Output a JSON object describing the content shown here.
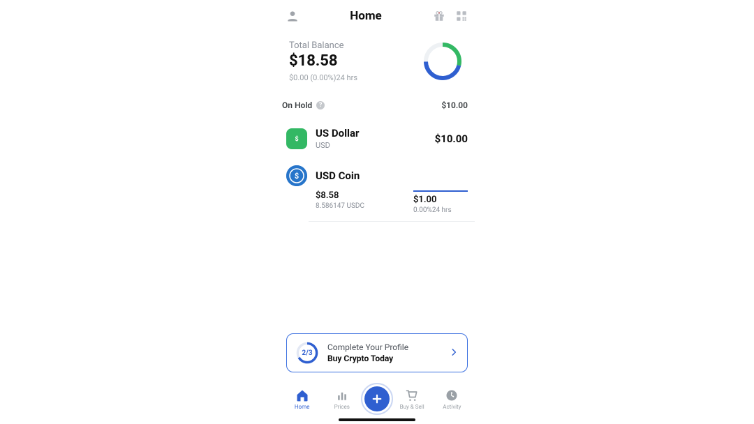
{
  "header": {
    "title": "Home"
  },
  "balance": {
    "label": "Total Balance",
    "amount": "$18.58",
    "change": "$0.00 (0.00%)24 hrs"
  },
  "onhold": {
    "label": "On Hold",
    "amount": "$10.00"
  },
  "assets": {
    "usd": {
      "name": "US Dollar",
      "code": "USD",
      "amount": "$10.00"
    },
    "usdc": {
      "name": "USD Coin",
      "balance": "$8.58",
      "quantity": "8.586147 USDC",
      "price": "$1.00",
      "change": "0.00%24 hrs"
    }
  },
  "profile_card": {
    "progress": "2/3",
    "line1": "Complete Your Profile",
    "line2": "Buy Crypto Today"
  },
  "tabs": {
    "home": "Home",
    "prices": "Prices",
    "buysell": "Buy & Sell",
    "activity": "Activity"
  },
  "chart_data": {
    "type": "pie",
    "title": "Total Balance breakdown",
    "series": [
      {
        "name": "USD (on hold)",
        "value": 10.0,
        "color": "#33b864"
      },
      {
        "name": "USD Coin",
        "value": 8.58,
        "color": "#2f5fd0"
      }
    ]
  }
}
